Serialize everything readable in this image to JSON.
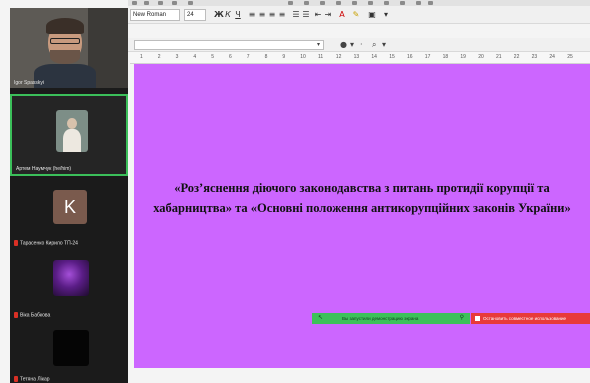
{
  "participants": [
    {
      "name": "Igor Spasskyi",
      "muted": false
    },
    {
      "name": "Артем Наумчук (he/him)",
      "muted": false,
      "active_speaker": true
    },
    {
      "name": "Тарасенко Кирило ТП-24",
      "muted": true,
      "initial": "K"
    },
    {
      "name": "Віка Бабкова",
      "muted": true
    },
    {
      "name": "Тетяна Лікар",
      "muted": true
    }
  ],
  "toolbar": {
    "font_name": "New Roman",
    "font_size": "24"
  },
  "ruler": {
    "ticks": [
      "1",
      "2",
      "3",
      "4",
      "5",
      "6",
      "7",
      "8",
      "9",
      "10",
      "11",
      "12",
      "13",
      "14",
      "15",
      "16",
      "17",
      "18",
      "19",
      "20",
      "21",
      "22",
      "23",
      "24",
      "25"
    ]
  },
  "slide": {
    "title": "«Роз’яснення діючого законодавства з питань протидії корупції та хабарництва» та «Основні положення антикорупційних законів України»",
    "background": "#cc66ff"
  },
  "share_notice": {
    "text": "Вы запустили демонстрацию экрана",
    "stop_label": "Остановить совместное использование"
  },
  "colors": {
    "share_green": "#3cc15a",
    "stop_red": "#e83a3a",
    "active_border": "#3bbf5a"
  }
}
